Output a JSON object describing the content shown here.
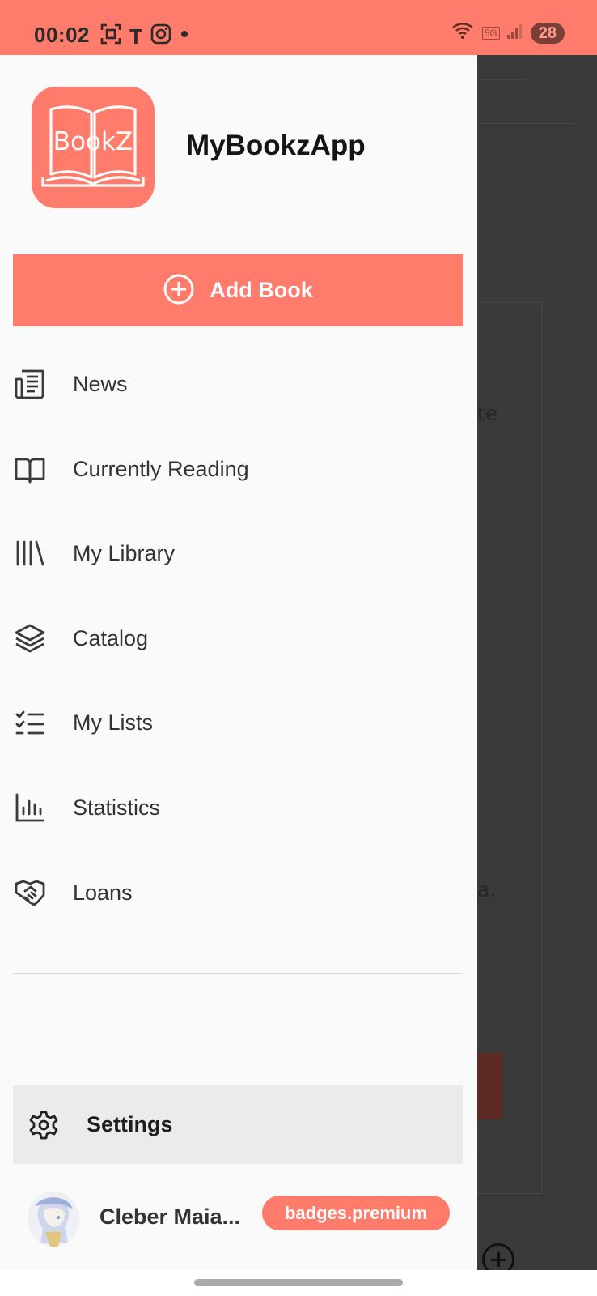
{
  "status_bar": {
    "time": "00:02",
    "letter_icon": "T",
    "battery": "28",
    "network": "5G",
    "icons": [
      "screenshot-icon",
      "instagram-icon",
      "dot-icon",
      "wifi-icon",
      "signal-icon"
    ]
  },
  "colors": {
    "accent": "#ff7b6b",
    "drawer_bg": "#fafafa",
    "scrim": "#3a3a3a",
    "settings_bg": "#ebebeb"
  },
  "drawer": {
    "app_name": "MyBookzApp",
    "logo_text": "BookZ",
    "add_book_label": "Add Book",
    "menu": [
      {
        "label": "News",
        "icon": "newspaper-icon"
      },
      {
        "label": "Currently Reading",
        "icon": "open-book-icon"
      },
      {
        "label": "My Library",
        "icon": "library-icon"
      },
      {
        "label": "Catalog",
        "icon": "layers-icon"
      },
      {
        "label": "My Lists",
        "icon": "checklist-icon"
      },
      {
        "label": "Statistics",
        "icon": "bar-chart-icon"
      },
      {
        "label": "Loans",
        "icon": "handshake-icon"
      }
    ],
    "settings_label": "Settings",
    "user": {
      "name": "Cleber Maia...",
      "badge": "badges.premium"
    }
  },
  "background": {
    "fragment_1": "te",
    "fragment_2": "a."
  }
}
